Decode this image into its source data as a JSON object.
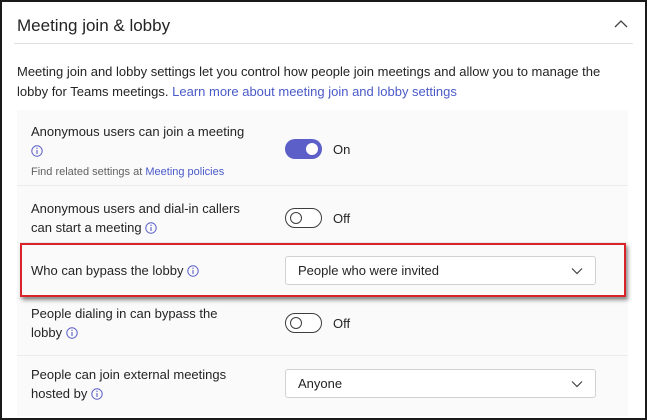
{
  "section": {
    "title": "Meeting join & lobby",
    "description": "Meeting join and lobby settings let you control how people join meetings and allow you to manage the lobby for Teams meetings.",
    "learn_more_link": "Learn more about meeting join and lobby settings"
  },
  "settings": {
    "anonymous_join": {
      "label": "Anonymous users can join a meeting",
      "sub_prefix": "Find related settings at",
      "sub_link": "Meeting policies",
      "toggle_state": "On"
    },
    "anonymous_start": {
      "label_line1": "Anonymous users and dial-in callers",
      "label_line2": "can start a meeting",
      "toggle_state": "Off"
    },
    "bypass_lobby": {
      "label": "Who can bypass the lobby",
      "value": "People who were invited"
    },
    "dialin_bypass": {
      "label_line1": "People dialing in can bypass the",
      "label_line2": "lobby",
      "toggle_state": "Off"
    },
    "external_meetings": {
      "label_line1": "People can join external meetings",
      "label_line2": "hosted by",
      "value": "Anyone"
    }
  },
  "colors": {
    "accent": "#5b5fc7",
    "link": "#4a5ac8",
    "highlight": "#d9232a"
  },
  "icons": [
    "chevron-up-icon",
    "info-icon",
    "chevron-down-icon"
  ]
}
